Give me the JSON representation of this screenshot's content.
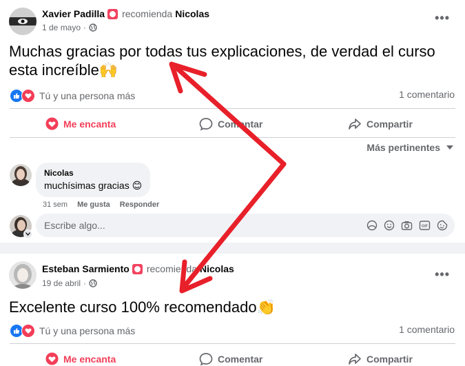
{
  "posts": [
    {
      "author": "Xavier Padilla",
      "recommends": "recomienda",
      "page": "Nicolas",
      "date": "1 de mayo",
      "dot": "·",
      "text": "Muchas gracias por todas tus explicaciones, de verdad el curso esta increíble🙌",
      "reactions_text": "Tú y una persona más",
      "comments": "1 comentario",
      "actions": {
        "love": "Me encanta",
        "comment": "Comentar",
        "share": "Compartir"
      },
      "sort_label": "Más pertinentes",
      "comment": {
        "author": "Nicolas",
        "text": "muchísimas gracias 😊",
        "time": "31 sem",
        "like": "Me gusta",
        "reply": "Responder"
      },
      "write_placeholder": "Escribe algo..."
    },
    {
      "author": "Esteban Sarmiento",
      "recommends": "recomienda",
      "page": "Nicolas",
      "date": "19 de abril",
      "dot": "·",
      "text": "Excelente curso 100% recomendado👏",
      "reactions_text": "Tú y una persona más",
      "comments": "1 comentario",
      "actions": {
        "love": "Me encanta",
        "comment": "Comentar",
        "share": "Compartir"
      }
    }
  ],
  "colors": {
    "annotation_arrow": "#e8202a",
    "love": "#f33e58",
    "like": "#1877f2"
  }
}
